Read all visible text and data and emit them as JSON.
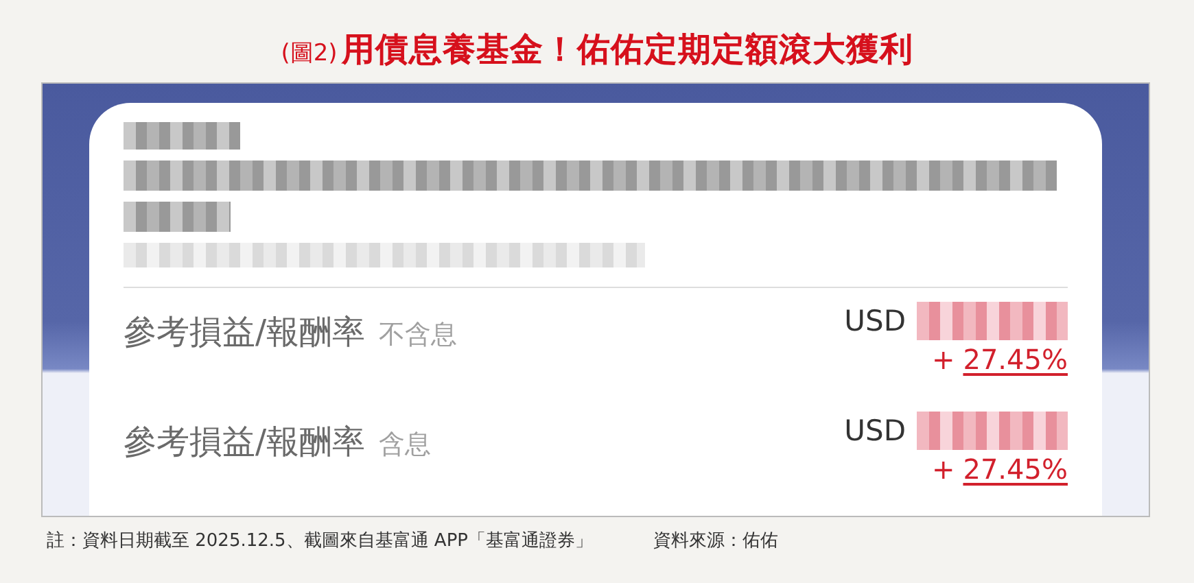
{
  "title": {
    "prefix": "(圖2)",
    "text": "用債息養基金！佑佑定期定額滾大獲利"
  },
  "card": {
    "rows": [
      {
        "label": "參考損益/報酬率",
        "note": "不含息",
        "currency": "USD",
        "sign": "+",
        "change": "27.45%"
      },
      {
        "label": "參考損益/報酬率",
        "note": "含息",
        "currency": "USD",
        "sign": "+",
        "change": "27.45%"
      }
    ]
  },
  "footer": {
    "note": "註：資料日期截至 2025.12.5、截圖來自基富通 APP「基富通證券」",
    "source": "資料來源：佑佑"
  }
}
